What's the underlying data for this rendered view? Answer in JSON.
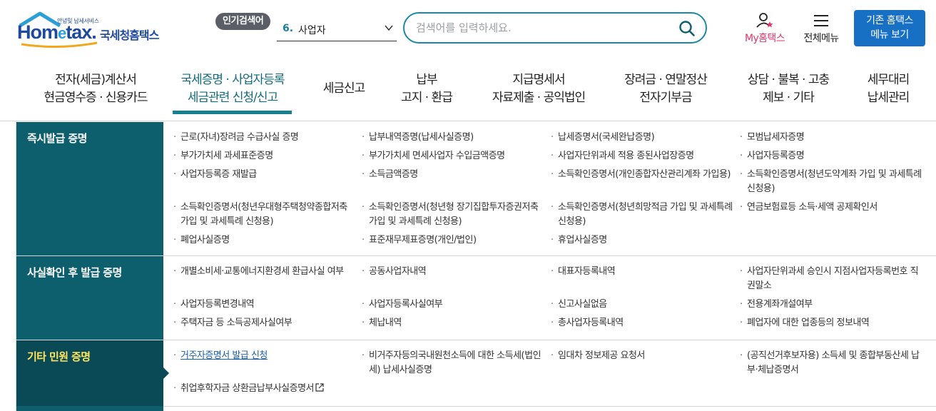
{
  "header": {
    "logo_small_text": "안녕및 납세서비스",
    "logo_word_prefix": "Hom",
    "logo_word_e": "e",
    "logo_word_suffix": "tax.",
    "logo_korean": "국세청홈택스",
    "popular_tag": "인기검색어",
    "popular_rank": "6.",
    "popular_keyword": "사업자",
    "search_placeholder": "검색어를 입력하세요.",
    "my_hometax": "My홈택스",
    "all_menu": "전체메뉴",
    "legacy_line1": "기존 홈택스",
    "legacy_line2": "메뉴 보기"
  },
  "gnb": [
    {
      "line1": "전자(세금)계산서",
      "line2": "현금영수증 · 신용카드"
    },
    {
      "line1": "국세증명 · 사업자등록",
      "line2": "세금관련 신청/신고",
      "active": true
    },
    {
      "line1": "세금신고",
      "line2": ""
    },
    {
      "line1": "납부",
      "line2": "고지 · 환급"
    },
    {
      "line1": "지급명세서",
      "line2": "자료제출 · 공익법인"
    },
    {
      "line1": "장려금 · 연말정산",
      "line2": "전자기부금"
    },
    {
      "line1": "상담 · 불복 · 고충",
      "line2": "제보 · 기타"
    },
    {
      "line1": "세무대리",
      "line2": "납세관리"
    }
  ],
  "categories": [
    {
      "title": "즉시발급 증명",
      "items": [
        "근로(자녀)장려금 수급사실 증명",
        "납부내역증명(납세사실증명)",
        "납세증명서(국세완납증명)",
        "모범납세자증명",
        "부가가치세 과세표준증명",
        "부가가치세 면세사업자 수입금액증명",
        "사업자단위과세 적용 종된사업장증명",
        "사업자등록증명",
        "사업자등록증 재발급",
        "소득금액증명",
        "소득확인증명서(개인종합자산관리계좌 가입용)",
        "소득확인증명서(청년도약계좌 가입 및 과세특례 신청용)",
        "소득확인증명서(청년우대형주택청약종합저축 가입 및 과세특례 신청용)",
        "소득확인증명서(청년형 장기집합투자증권저축 가입 및 과세특례 신청용)",
        "소득확인증명서(청년희망적금 가입 및 과세특례 신청용)",
        "연금보험료등 소득·세액 공제확인서",
        "폐업사실증명",
        "표준재무제표증명(개인/법인)",
        "휴업사실증명"
      ]
    },
    {
      "title": "사실확인 후 발급 증명",
      "items": [
        "개별소비세·교통에너지환경세 환급사실 여부",
        "공동사업자내역",
        "대표자등록내역",
        "사업자단위과세 승인시 지점사업자등록번호 직권말소",
        "사업자등록변경내역",
        "사업자등록사실여부",
        "신고사실없음",
        "전용계좌개설여부",
        "주택자금 등 소득공제사실여부",
        "체납내역",
        "총사업자등록내역",
        "폐업자에 대한 업종등의 정보내역"
      ]
    },
    {
      "title": "기타 민원 증명",
      "items": [
        "거주자증명서 발급 신청",
        "비거주자등의국내원천소득에 대한 소득세(법인세) 납세사실증명",
        "임대차 정보제공 요청서",
        "(공직선거후보자용) 소득세 및 종합부동산세 납부·체납증명서",
        "취업후학자금 상환금납부사실증명서"
      ]
    }
  ]
}
